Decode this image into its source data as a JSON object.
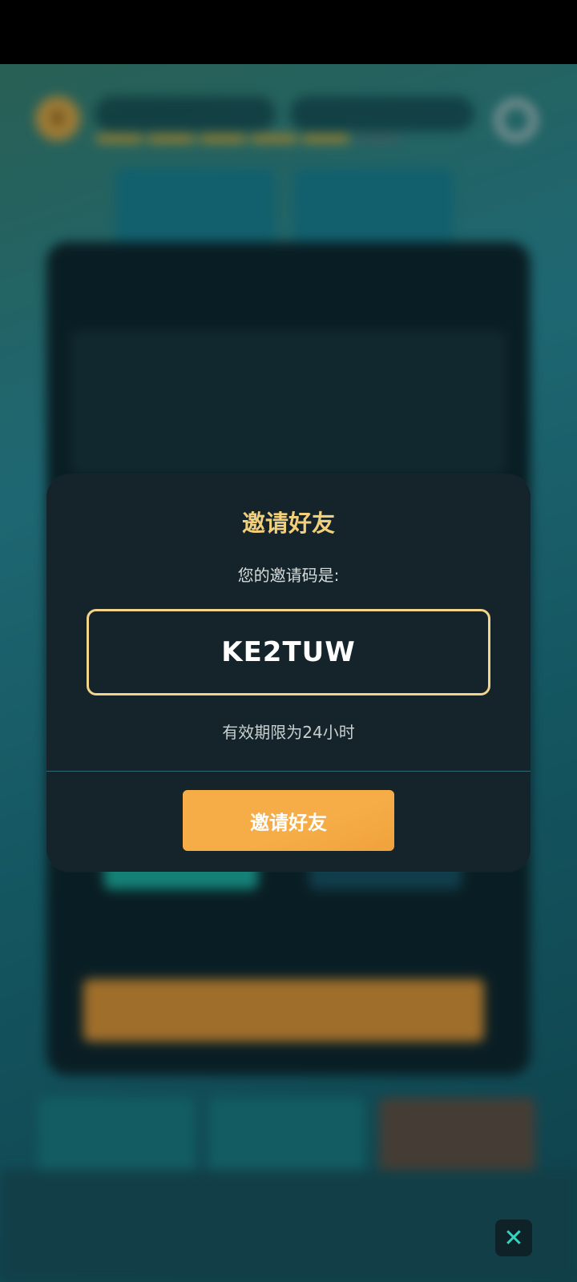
{
  "dialog": {
    "title": "邀请好友",
    "prompt": "您的邀请码是:",
    "invite_code": "KE2TUW",
    "validity": "有效期限为24小时",
    "invite_button": "邀请好友"
  },
  "hud": {
    "level": "6"
  },
  "icons": [
    "close-icon",
    "gear-icon"
  ],
  "colors": {
    "dialog_bg": "#14242a",
    "title": "#f2cf7a",
    "code_border": "#f2d48a",
    "button": "#f6ad47",
    "close_icon": "#35d4c0"
  }
}
